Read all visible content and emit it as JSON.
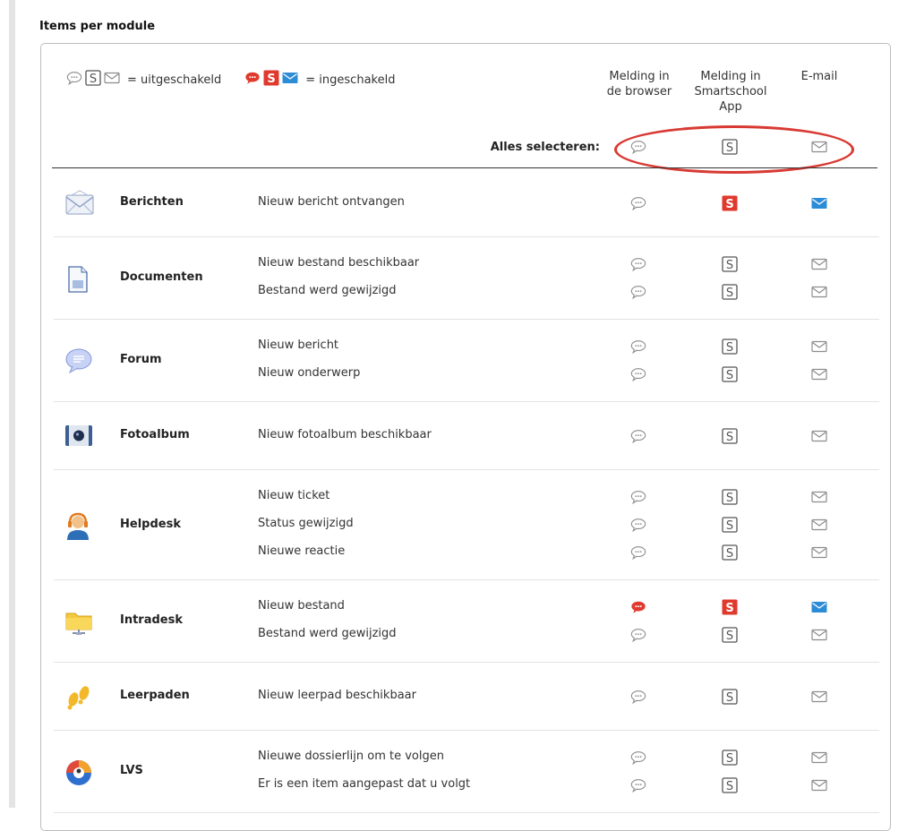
{
  "section_title": "Items per module",
  "legend": {
    "off_label": "= uitgeschakeld",
    "on_label": "= ingeschakeld"
  },
  "columns": {
    "browser": {
      "line1": "Melding in",
      "line2": "de browser"
    },
    "app": {
      "line1": "Melding in",
      "line2": "Smartschool",
      "line3": "App"
    },
    "email": {
      "line1": "E-mail"
    }
  },
  "select_all_label": "Alles selecteren:",
  "colors": {
    "on_red": "#e0392d",
    "on_blue": "#2d8cd6",
    "off_gray": "#8c8c8c",
    "highlight": "#d83a33"
  },
  "modules": [
    {
      "name": "Berichten",
      "icon": "envelope-icon",
      "events": [
        {
          "label": "Nieuw bericht ontvangen",
          "browser": false,
          "app": true,
          "email": true
        }
      ]
    },
    {
      "name": "Documenten",
      "icon": "document-icon",
      "events": [
        {
          "label": "Nieuw bestand beschikbaar",
          "browser": false,
          "app": false,
          "email": false
        },
        {
          "label": "Bestand werd gewijzigd",
          "browser": false,
          "app": false,
          "email": false
        }
      ]
    },
    {
      "name": "Forum",
      "icon": "speech-bubble-icon",
      "events": [
        {
          "label": "Nieuw bericht",
          "browser": false,
          "app": false,
          "email": false
        },
        {
          "label": "Nieuw onderwerp",
          "browser": false,
          "app": false,
          "email": false
        }
      ]
    },
    {
      "name": "Fotoalbum",
      "icon": "camera-icon",
      "events": [
        {
          "label": "Nieuw fotoalbum beschikbaar",
          "browser": false,
          "app": false,
          "email": false
        }
      ]
    },
    {
      "name": "Helpdesk",
      "icon": "headset-user-icon",
      "events": [
        {
          "label": "Nieuw ticket",
          "browser": false,
          "app": false,
          "email": false
        },
        {
          "label": "Status gewijzigd",
          "browser": false,
          "app": false,
          "email": false
        },
        {
          "label": "Nieuwe reactie",
          "browser": false,
          "app": false,
          "email": false
        }
      ]
    },
    {
      "name": "Intradesk",
      "icon": "network-folder-icon",
      "events": [
        {
          "label": "Nieuw bestand",
          "browser": true,
          "app": true,
          "email": true
        },
        {
          "label": "Bestand werd gewijzigd",
          "browser": false,
          "app": false,
          "email": false
        }
      ]
    },
    {
      "name": "Leerpaden",
      "icon": "footprints-icon",
      "events": [
        {
          "label": "Nieuw leerpad beschikbaar",
          "browser": false,
          "app": false,
          "email": false
        }
      ]
    },
    {
      "name": "LVS",
      "icon": "lvs-icon",
      "events": [
        {
          "label": "Nieuwe dossierlijn om te volgen",
          "browser": false,
          "app": false,
          "email": false
        },
        {
          "label": "Er is een item aangepast dat u volgt",
          "browser": false,
          "app": false,
          "email": false
        }
      ]
    }
  ]
}
